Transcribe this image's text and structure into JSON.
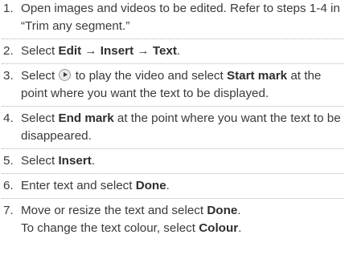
{
  "steps": [
    {
      "number": "1.",
      "text": "Open images and videos to be edited. Refer to steps 1-4 in “Trim any segment.”"
    },
    {
      "number": "2.",
      "select": "Select",
      "edit": "Edit",
      "arrow1": "→",
      "insert": "Insert",
      "arrow2": "→",
      "text_item": "Text",
      "end": "."
    },
    {
      "number": "3.",
      "select": "Select",
      "play_icon": "play-icon",
      "middle": "to play the video and select",
      "start_mark": "Start mark",
      "end": "at the point where you want the text to be displayed."
    },
    {
      "number": "4.",
      "select": "Select",
      "end_mark": "End mark",
      "end": "at the point where you want the text to be disappeared."
    },
    {
      "number": "5.",
      "select": "Select",
      "insert": "Insert",
      "end": "."
    },
    {
      "number": "6.",
      "lead": "Enter text and select",
      "done": "Done",
      "end": "."
    },
    {
      "number": "7.",
      "lead": "Move or resize the text and select",
      "done": "Done",
      "end": ".",
      "line2_lead": "To change the text colour, select",
      "colour": "Colour",
      "line2_end": "."
    }
  ]
}
